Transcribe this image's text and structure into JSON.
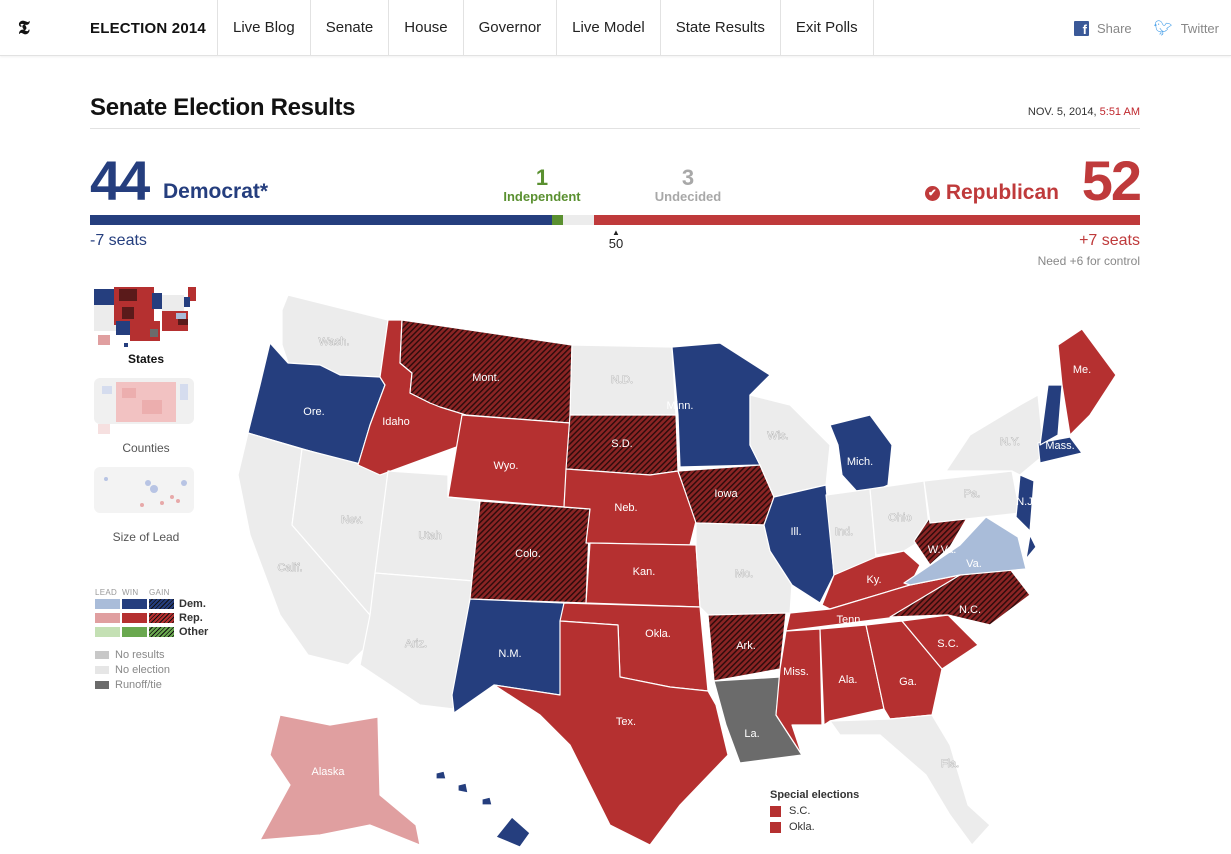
{
  "header": {
    "logo": "𝕿",
    "brand": "ELECTION 2014",
    "nav": [
      "Live Blog",
      "Senate",
      "House",
      "Governor",
      "Live Model",
      "State Results",
      "Exit Polls"
    ],
    "share_label": "Share",
    "twitter_label": "Twitter"
  },
  "page": {
    "title": "Senate Election Results",
    "date": "NOV. 5, 2014,",
    "time": "5:51 AM"
  },
  "colors": {
    "dem": "#253e7e",
    "rep": "#b53030",
    "ind": "#5a9030",
    "undecided": "#ececec",
    "dem_lead": "#a9bcd9",
    "rep_lead": "#e09fa0",
    "no_election": "#ececec",
    "runoff": "#6b6b6b"
  },
  "tally": {
    "dem_seats": "44",
    "dem_label": "Democrat*",
    "dem_change": "-7 seats",
    "ind_seats": "1",
    "ind_label": "Independent",
    "undecided_seats": "3",
    "undecided_label": "Undecided",
    "rep_seats": "52",
    "rep_label": "Republican",
    "rep_change": "+7 seats",
    "rep_note": "Need +6 for control",
    "majority_marker": "50",
    "bar": {
      "dem": 44,
      "ind": 1,
      "undecided": 3,
      "rep": 52,
      "total": 100
    }
  },
  "views": [
    {
      "label": "States",
      "active": true
    },
    {
      "label": "Counties",
      "active": false
    },
    {
      "label": "Size of Lead",
      "active": false
    }
  ],
  "legend": {
    "columns": [
      "LEAD",
      "WIN",
      "GAIN"
    ],
    "rows": [
      "Dem.",
      "Rep.",
      "Other"
    ],
    "extra": [
      "No results",
      "No election",
      "Runoff/tie"
    ]
  },
  "special_elections": {
    "title": "Special elections",
    "items": [
      "S.C.",
      "Okla."
    ]
  },
  "states": [
    {
      "abbr": "Wash.",
      "status": "none"
    },
    {
      "abbr": "Ore.",
      "status": "dem"
    },
    {
      "abbr": "Calif.",
      "status": "none"
    },
    {
      "abbr": "Nev.",
      "status": "none"
    },
    {
      "abbr": "Idaho",
      "status": "rep"
    },
    {
      "abbr": "Mont.",
      "status": "rep_gain"
    },
    {
      "abbr": "Wyo.",
      "status": "rep"
    },
    {
      "abbr": "Utah",
      "status": "none"
    },
    {
      "abbr": "Ariz.",
      "status": "none"
    },
    {
      "abbr": "Colo.",
      "status": "rep_gain"
    },
    {
      "abbr": "N.M.",
      "status": "dem"
    },
    {
      "abbr": "N.D.",
      "status": "none"
    },
    {
      "abbr": "S.D.",
      "status": "rep_gain"
    },
    {
      "abbr": "Neb.",
      "status": "rep"
    },
    {
      "abbr": "Kan.",
      "status": "rep"
    },
    {
      "abbr": "Okla.",
      "status": "rep"
    },
    {
      "abbr": "Tex.",
      "status": "rep"
    },
    {
      "abbr": "Minn.",
      "status": "dem"
    },
    {
      "abbr": "Iowa",
      "status": "rep_gain"
    },
    {
      "abbr": "Mo.",
      "status": "none"
    },
    {
      "abbr": "Ark.",
      "status": "rep_gain"
    },
    {
      "abbr": "La.",
      "status": "runoff"
    },
    {
      "abbr": "Wis.",
      "status": "none"
    },
    {
      "abbr": "Ill.",
      "status": "dem"
    },
    {
      "abbr": "Mich.",
      "status": "dem"
    },
    {
      "abbr": "Ind.",
      "status": "none"
    },
    {
      "abbr": "Ohio",
      "status": "none"
    },
    {
      "abbr": "Ky.",
      "status": "rep"
    },
    {
      "abbr": "Tenn.",
      "status": "rep"
    },
    {
      "abbr": "Miss.",
      "status": "rep"
    },
    {
      "abbr": "Ala.",
      "status": "rep"
    },
    {
      "abbr": "Ga.",
      "status": "rep"
    },
    {
      "abbr": "Fla.",
      "status": "none"
    },
    {
      "abbr": "S.C.",
      "status": "rep"
    },
    {
      "abbr": "N.C.",
      "status": "rep_gain"
    },
    {
      "abbr": "Va.",
      "status": "dem_lead"
    },
    {
      "abbr": "W.Va.",
      "status": "rep_gain"
    },
    {
      "abbr": "Pa.",
      "status": "none"
    },
    {
      "abbr": "N.Y.",
      "status": "none"
    },
    {
      "abbr": "N.J.",
      "status": "dem"
    },
    {
      "abbr": "Mass.",
      "status": "dem"
    },
    {
      "abbr": "Me.",
      "status": "rep"
    },
    {
      "abbr": "Alaska",
      "status": "rep_lead"
    },
    {
      "abbr": "Hawaii",
      "status": "dem"
    }
  ]
}
